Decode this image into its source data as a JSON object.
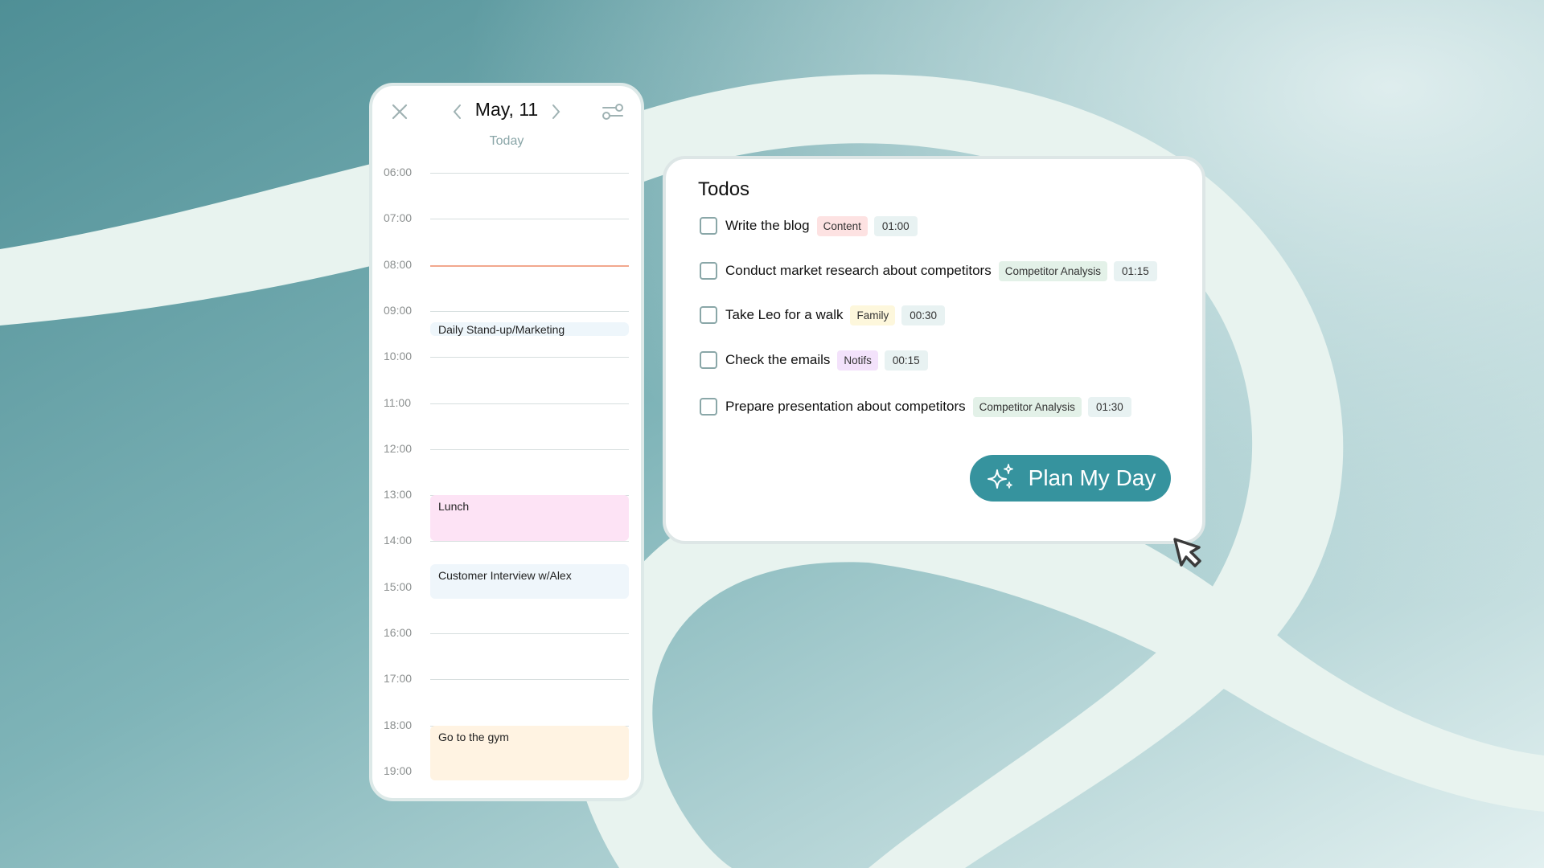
{
  "calendar": {
    "date_label": "May, 11",
    "subtitle": "Today",
    "close_icon": "close-icon",
    "prev_icon": "chevron-left-icon",
    "next_icon": "chevron-right-icon",
    "filter_icon": "filter-sliders-icon",
    "hours": [
      "06:00",
      "07:00",
      "08:00",
      "09:00",
      "10:00",
      "11:00",
      "12:00",
      "13:00",
      "14:00",
      "15:00",
      "16:00",
      "17:00",
      "18:00",
      "19:00"
    ],
    "current_time_hour": "08:00",
    "current_time_color": "#f2a88e",
    "events": [
      {
        "title": "Daily Stand-up/Marketing",
        "start": 9.25,
        "end": 9.55,
        "color": "#eef6fb"
      },
      {
        "title": "Lunch",
        "start": 13.0,
        "end": 14.0,
        "color": "#fde3f5"
      },
      {
        "title": "Customer Interview w/Alex",
        "start": 14.5,
        "end": 15.25,
        "color": "#eff6fb"
      },
      {
        "title": "Go to the gym",
        "start": 18.0,
        "end": 19.2,
        "color": "#fff3e2"
      }
    ]
  },
  "todos": {
    "title": "Todos",
    "items": [
      {
        "label": "Write the blog",
        "tag": "Content",
        "tag_color": "#fde2e2",
        "duration": "01:00",
        "checked": false
      },
      {
        "label": "Conduct market research about competitors",
        "tag": "Competitor Analysis",
        "tag_color": "#e3f1e8",
        "duration": "01:15",
        "checked": false
      },
      {
        "label": "Take Leo for a walk",
        "tag": "Family",
        "tag_color": "#fdf7dc",
        "duration": "00:30",
        "checked": false
      },
      {
        "label": "Check the emails",
        "tag": "Notifs",
        "tag_color": "#f3e2fb",
        "duration": "00:15",
        "checked": false
      },
      {
        "label": "Prepare presentation about competitors",
        "tag": "Competitor Analysis",
        "tag_color": "#e3f1e8",
        "duration": "01:30",
        "checked": false
      }
    ],
    "plan_button": {
      "label": "Plan My Day",
      "icon": "sparkles-icon",
      "color": "#36939e"
    }
  },
  "cursor_icon": "mouse-pointer-icon"
}
